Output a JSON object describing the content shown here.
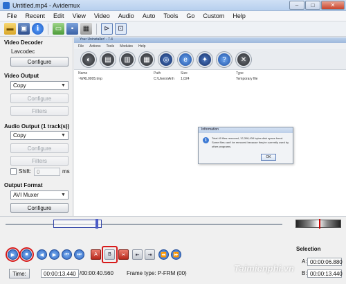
{
  "window": {
    "title": "Untitled.mp4 - Avidemux"
  },
  "menu": [
    "File",
    "Recent",
    "Edit",
    "View",
    "Video",
    "Audio",
    "Auto",
    "Tools",
    "Go",
    "Custom",
    "Help"
  ],
  "left_panel": {
    "video_decoder": {
      "title": "Video Decoder",
      "value": "Lavcodec",
      "configure": "Configure"
    },
    "video_output": {
      "title": "Video Output",
      "selected": "Copy",
      "configure": "Configure",
      "filters": "Filters"
    },
    "audio_output": {
      "title": "Audio Output (1 track(s))",
      "selected": "Copy",
      "configure": "Configure",
      "filters": "Filters",
      "shift_label": "Shift:",
      "shift_value": "0",
      "shift_unit": "ms"
    },
    "output_format": {
      "title": "Output Format",
      "selected": "AVI Muxer",
      "configure": "Configure"
    }
  },
  "embedded": {
    "title": "Your Uninstaller! - 7.4",
    "menu": [
      "File",
      "Actions",
      "Tools",
      "Modules",
      "Help"
    ],
    "columns": [
      "Name",
      "Path",
      "Size",
      "Type"
    ],
    "row": {
      "name": "~WRL0005.tmp",
      "path": "C:\\Users\\Anh",
      "size": "1,024",
      "type": "Temporary file"
    },
    "dialog": {
      "title": "Information",
      "message": "Total 40 files removed, 12,308,434 bytes disk space freed. Some files can't be removed because they're currently used by other programs.",
      "ok": "OK"
    }
  },
  "controls": {
    "time_button": "Time:",
    "current_time": "00:00:13.440",
    "total_time": "/00:00:40.560",
    "frame_type": "Frame type:  P-FRM (00)",
    "selection": {
      "title": "Selection",
      "a_label": "A:",
      "a_value": "00:00:06.880",
      "b_label": "B:",
      "b_value": "00:00:13.440"
    },
    "marker_a": "A",
    "marker_b": "B"
  },
  "watermark": "Taimienphi.vn"
}
